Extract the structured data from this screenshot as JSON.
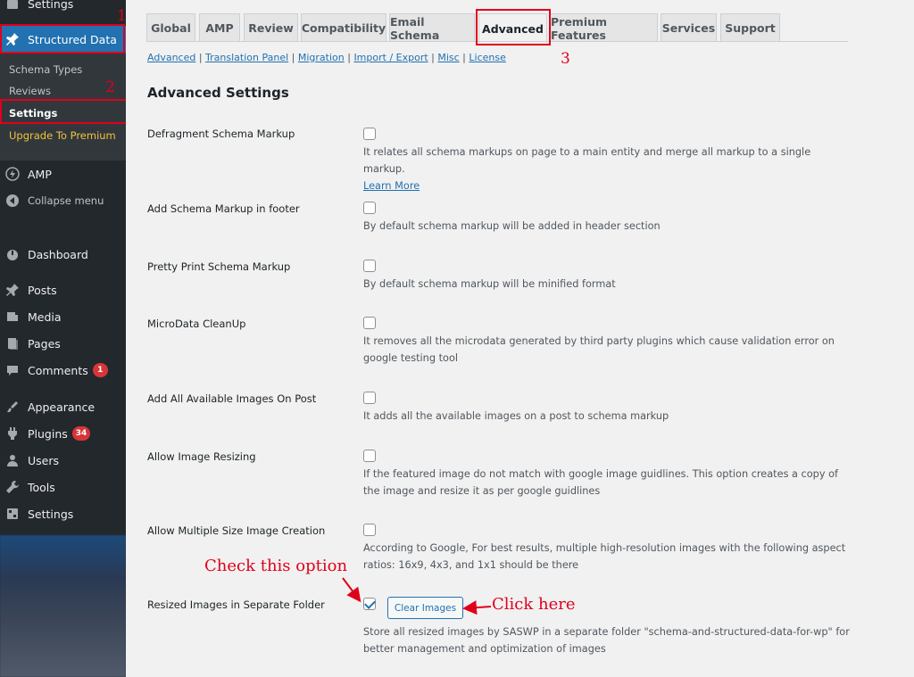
{
  "sidebar": {
    "top_item": "Settings",
    "structured_data": "Structured Data",
    "sub_items": [
      "Schema Types",
      "Reviews",
      "Settings",
      "Upgrade To Premium"
    ],
    "amp": "AMP",
    "collapse": "Collapse menu",
    "menu": [
      {
        "label": "Dashboard",
        "icon": "dashboard-icon"
      },
      {
        "label": "Posts",
        "icon": "pin-icon"
      },
      {
        "label": "Media",
        "icon": "media-icon"
      },
      {
        "label": "Pages",
        "icon": "pages-icon"
      },
      {
        "label": "Comments",
        "icon": "comment-icon",
        "badge": "1"
      },
      {
        "label": "Appearance",
        "icon": "brush-icon"
      },
      {
        "label": "Plugins",
        "icon": "plugin-icon",
        "badge": "34"
      },
      {
        "label": "Users",
        "icon": "user-icon"
      },
      {
        "label": "Tools",
        "icon": "wrench-icon"
      },
      {
        "label": "Settings",
        "icon": "settings-icon"
      }
    ],
    "annot_1": "1",
    "annot_2": "2"
  },
  "tabs": [
    "Global",
    "AMP",
    "Review",
    "Compatibility",
    "Email Schema",
    "Advanced",
    "Premium Features",
    "Services",
    "Support"
  ],
  "active_tab": "Advanced",
  "annot_3": "3",
  "sublinks": [
    "Advanced",
    "Translation Panel",
    "Migration",
    "Import / Export",
    "Misc",
    "License"
  ],
  "heading": "Advanced Settings",
  "rows": [
    {
      "label": "Defragment Schema Markup",
      "desc": "It relates all schema markups on page to a main entity and merge all markup to a single markup.",
      "link": "Learn More"
    },
    {
      "label": "Add Schema Markup in footer",
      "desc": "By default schema markup will be added in header section"
    },
    {
      "label": "Pretty Print Schema Markup",
      "desc": "By default schema markup will be minified format"
    },
    {
      "label": "MicroData CleanUp",
      "desc": "It removes all the microdata generated by third party plugins which cause validation error on google testing tool"
    },
    {
      "label": "Add All Available Images On Post",
      "desc": "It adds all the available images on a post to schema markup"
    },
    {
      "label": "Allow Image Resizing",
      "desc": "If the featured image do not match with google image guidlines. This option creates a copy of the image and resize it as per google guidlines"
    },
    {
      "label": "Allow Multiple Size Image Creation",
      "desc": "According to Google, For best results, multiple high-resolution images with the following aspect ratios: 16x9, 4x3, and 1x1 should be there"
    },
    {
      "label": "Resized Images in Separate Folder",
      "desc": "Store all resized images by SASWP in a separate folder \"schema-and-structured-data-for-wp\" for better management and optimization of images",
      "checked": true
    }
  ],
  "clear_button": "Clear Images",
  "annot_check": "Check this option",
  "annot_click": "Click here"
}
